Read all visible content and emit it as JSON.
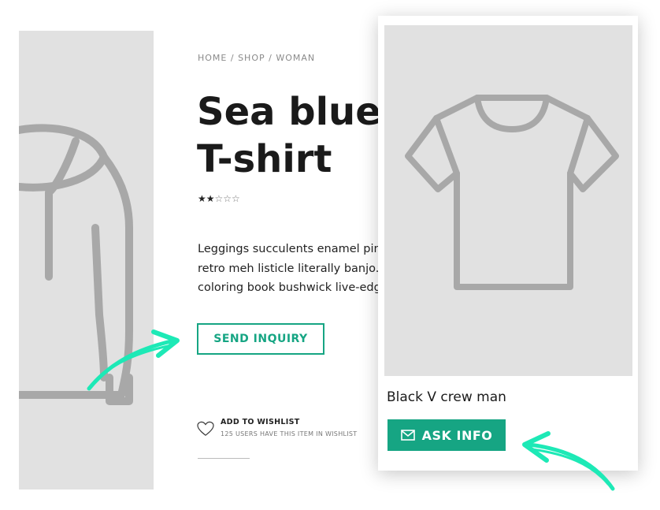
{
  "breadcrumb": "HOME / SHOP / WOMAN",
  "product": {
    "title_line1": "Sea blue",
    "title_line2": "T-shirt",
    "rating": 2,
    "rating_max": 5,
    "stars_filled": "★★",
    "stars_empty": "☆☆☆",
    "description_lines": [
      "Leggings succulents enamel pin",
      "retro meh listicle literally banjo. E",
      "coloring book bushwick live-edg"
    ]
  },
  "send_inquiry_label": "SEND INQUIRY",
  "wishlist": {
    "label": "ADD TO WISHLIST",
    "count_text": "125 USERS HAVE THIS ITEM IN WISHLIST"
  },
  "card": {
    "name": "Black V crew man",
    "ask_label": "ASK INFO"
  },
  "icons": {
    "left_image": "hoodie-icon",
    "card_image": "tshirt-icon",
    "rating": "star-icon",
    "wishlist": "heart-icon",
    "ask": "envelope-icon",
    "annotation": "arrow-icon"
  },
  "colors": {
    "accent": "#16a583",
    "arrow": "#1de9b6",
    "placeholder_bg": "#e1e1e1",
    "icon_gray": "#a8a8a8"
  }
}
